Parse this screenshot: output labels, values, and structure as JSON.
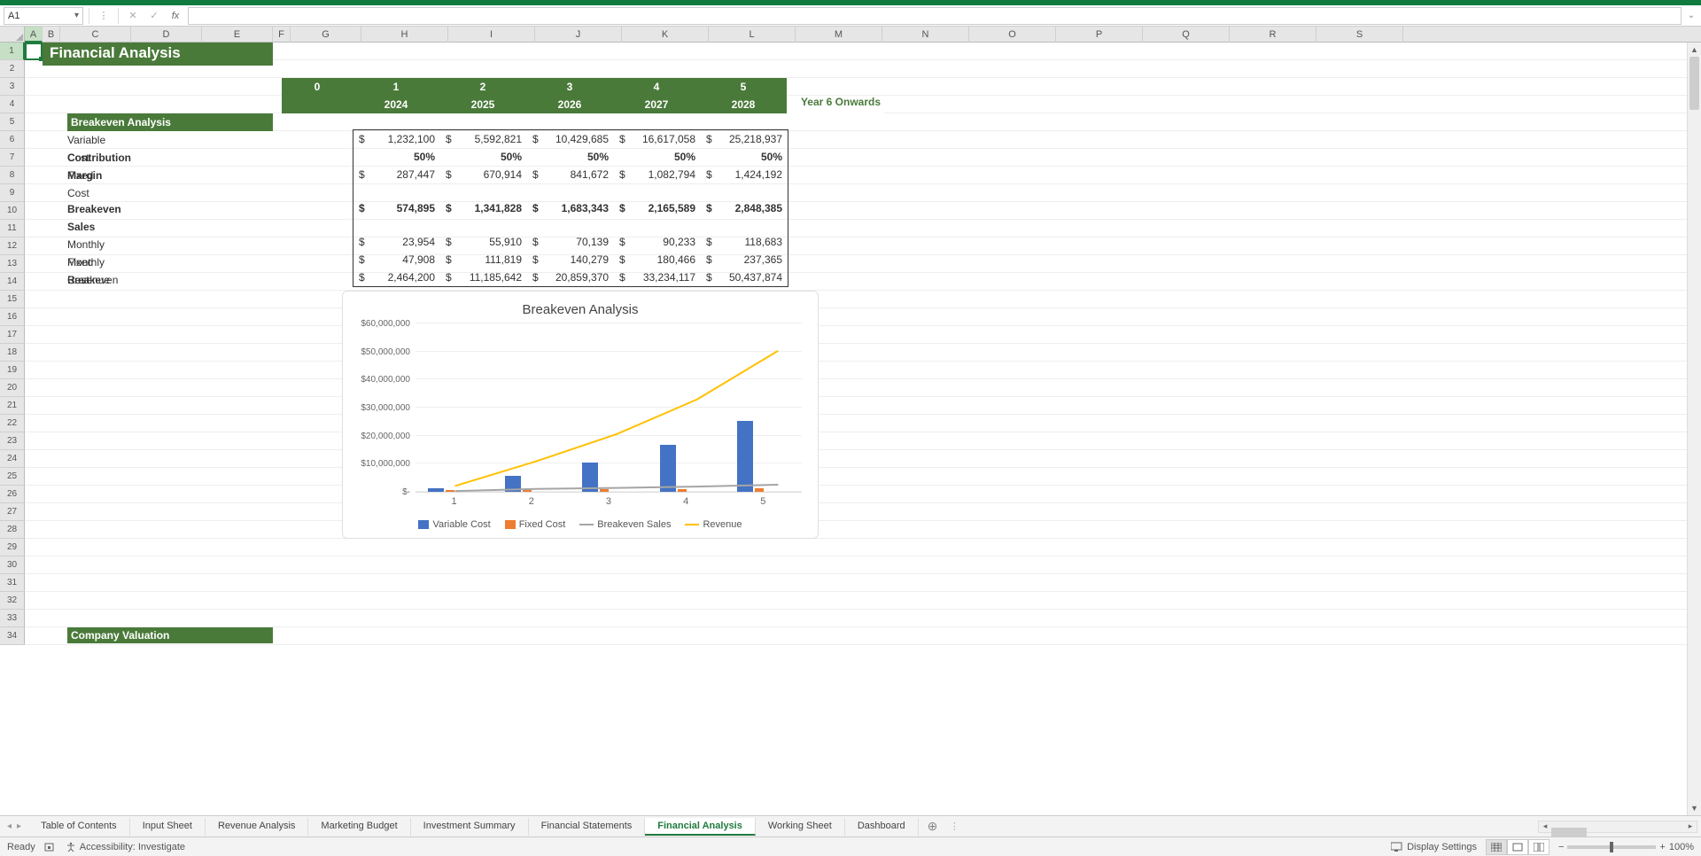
{
  "app": {
    "name_box": "A1",
    "formula": ""
  },
  "title": "Financial Analysis",
  "columns_visible": [
    "A",
    "B",
    "C",
    "D",
    "E",
    "F",
    "G",
    "H",
    "I",
    "J",
    "K",
    "L",
    "M",
    "N",
    "O",
    "P",
    "Q",
    "R",
    "S"
  ],
  "row_count_visible": 34,
  "periods": [
    "0",
    "1",
    "2",
    "3",
    "4",
    "5"
  ],
  "years": [
    "",
    "2024",
    "2025",
    "2026",
    "2027",
    "2028"
  ],
  "year6_label": "Year 6 Onwards",
  "section1": "Breakeven Analysis",
  "section2": "Company Valuation",
  "labels": {
    "variable_cost": "Variable Cost",
    "contribution_margin": "Contribution Margin",
    "fixed_cost": "Fixed Cost",
    "breakeven_sales": "Breakeven Sales",
    "monthly_fixed": "Monthly Fixed Cost",
    "monthly_breakeven": "Monthly Breakeven",
    "revenue": "Revenue"
  },
  "table": {
    "variable_cost": [
      "1,232,100",
      "5,592,821",
      "10,429,685",
      "16,617,058",
      "25,218,937"
    ],
    "contribution_margin": [
      "50%",
      "50%",
      "50%",
      "50%",
      "50%"
    ],
    "fixed_cost": [
      "287,447",
      "670,914",
      "841,672",
      "1,082,794",
      "1,424,192"
    ],
    "breakeven_sales": [
      "574,895",
      "1,341,828",
      "1,683,343",
      "2,165,589",
      "2,848,385"
    ],
    "monthly_fixed": [
      "23,954",
      "55,910",
      "70,139",
      "90,233",
      "118,683"
    ],
    "monthly_breakeven": [
      "47,908",
      "111,819",
      "140,279",
      "180,466",
      "237,365"
    ],
    "revenue": [
      "2,464,200",
      "11,185,642",
      "20,859,370",
      "33,234,117",
      "50,437,874"
    ]
  },
  "chart_data": {
    "type": "bar",
    "title": "Breakeven Analysis",
    "categories": [
      "1",
      "2",
      "3",
      "4",
      "5"
    ],
    "series": [
      {
        "name": "Variable Cost",
        "type": "bar",
        "color": "#4472c4",
        "values": [
          1232100,
          5592821,
          10429685,
          16617058,
          25218937
        ]
      },
      {
        "name": "Fixed Cost",
        "type": "bar",
        "color": "#ed7d31",
        "values": [
          287447,
          670914,
          841672,
          1082794,
          1424192
        ]
      },
      {
        "name": "Breakeven Sales",
        "type": "line",
        "color": "#a5a5a5",
        "values": [
          574895,
          1341828,
          1683343,
          2165589,
          2848385
        ]
      },
      {
        "name": "Revenue",
        "type": "line",
        "color": "#ffc000",
        "values": [
          2464200,
          11185642,
          20859370,
          33234117,
          50437874
        ]
      }
    ],
    "ylabel": "",
    "xlabel": "",
    "ylim": [
      0,
      60000000
    ],
    "yticks": [
      "$-",
      "$10,000,000",
      "$20,000,000",
      "$30,000,000",
      "$40,000,000",
      "$50,000,000",
      "$60,000,000"
    ]
  },
  "tabs": [
    "Table of Contents",
    "Input Sheet",
    "Revenue Analysis",
    "Marketing Budget",
    "Investment Summary",
    "Financial Statements",
    "Financial Analysis",
    "Working Sheet",
    "Dashboard"
  ],
  "active_tab": "Financial Analysis",
  "status": {
    "ready": "Ready",
    "accessibility": "Accessibility: Investigate",
    "display_settings": "Display Settings",
    "zoom": "100%"
  }
}
